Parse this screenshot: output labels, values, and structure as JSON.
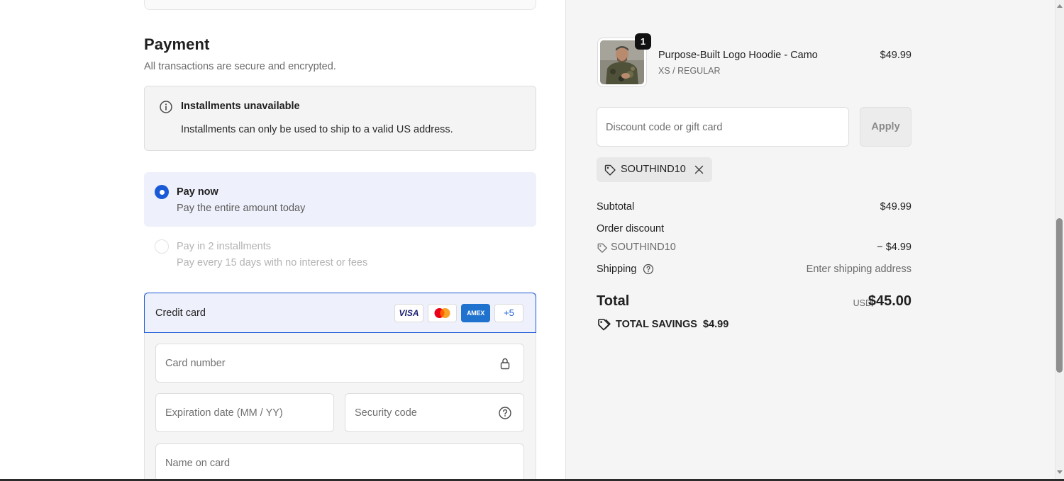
{
  "payment": {
    "title": "Payment",
    "subtitle": "All transactions are secure and encrypted.",
    "notice": {
      "title": "Installments unavailable",
      "body": "Installments can only be used to ship to a valid US address."
    },
    "options": [
      {
        "title": "Pay now",
        "subtitle": "Pay the entire amount today",
        "selected": true
      },
      {
        "title": "Pay in 2 installments",
        "subtitle": "Pay every 15 days with no interest or fees",
        "selected": false,
        "disabled": true
      }
    ],
    "credit_card": {
      "label": "Credit card",
      "brands": [
        "VISA",
        "mastercard-icon",
        "AMEX"
      ],
      "visa_label": "VISA",
      "amex_label": "AMEX",
      "more_brands": "+5",
      "fields": {
        "card_number": "Card number",
        "expiration": "Expiration date (MM / YY)",
        "security_code": "Security code",
        "name_on_card": "Name on card"
      }
    },
    "accent_color": "#1a5ad7"
  },
  "summary": {
    "product": {
      "name": "Purpose-Built Logo Hoodie - Camo",
      "variant": "XS / REGULAR",
      "price": "$49.99",
      "quantity": "1"
    },
    "discount": {
      "placeholder": "Discount code or gift card",
      "apply_label": "Apply",
      "applied_code": "SOUTHIND10"
    },
    "rows": {
      "subtotal_label": "Subtotal",
      "subtotal_value": "$49.99",
      "order_discount_label": "Order discount",
      "discount_code": "SOUTHIND10",
      "discount_value": "− $4.99",
      "shipping_label": "Shipping",
      "shipping_value": "Enter shipping address"
    },
    "total": {
      "label": "Total",
      "currency": "USD",
      "value": "$45.00"
    },
    "savings": {
      "label": "TOTAL SAVINGS",
      "value": "$4.99"
    }
  }
}
